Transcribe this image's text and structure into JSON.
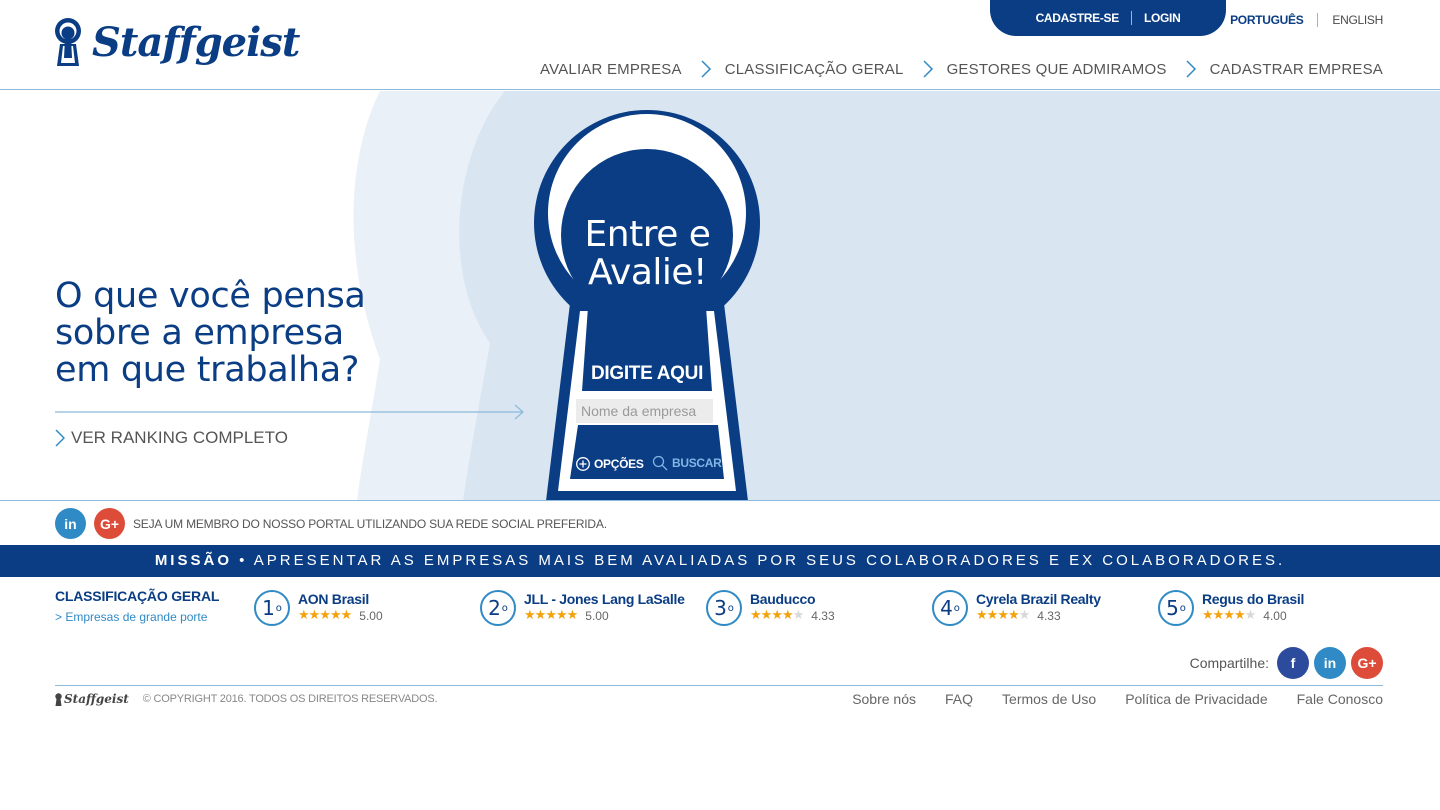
{
  "brand": {
    "name": "Staffgeist"
  },
  "account": {
    "signup": "CADASTRE-SE",
    "login": "LOGIN"
  },
  "language": {
    "pt": "PORTUGUÊS",
    "en": "ENGLISH"
  },
  "nav": {
    "items": [
      "AVALIAR EMPRESA",
      "CLASSIFICAÇÃO GERAL",
      "GESTORES QUE ADMIRAMOS",
      "CADASTRAR EMPRESA"
    ]
  },
  "hero": {
    "headline": [
      "O que você pensa",
      "sobre a empresa",
      "em que trabalha?"
    ],
    "ranking_link": "VER RANKING COMPLETO",
    "keyhole_title": [
      "Entre e",
      "Avalie!"
    ],
    "prompt": "DIGITE AQUI",
    "search_placeholder": "Nome da empresa",
    "options_label": "OPÇÕES",
    "search_label": "BUSCAR"
  },
  "social": {
    "linkedin": "in",
    "googleplus": "G+",
    "text": "SEJA UM MEMBRO DO NOSSO PORTAL UTILIZANDO SUA REDE SOCIAL PREFERIDA."
  },
  "mission": {
    "label": "MISSÃO",
    "bullet": "•",
    "text": "APRESENTAR AS EMPRESAS MAIS BEM AVALIADAS POR SEUS COLABORADORES E EX COLABORADORES."
  },
  "ranking": {
    "title": "CLASSIFICAÇÃO GERAL",
    "subtitle": "> Empresas de grande porte",
    "items": [
      {
        "pos": "1",
        "ord": "o",
        "name": "AON Brasil",
        "stars": 5,
        "score": "5.00"
      },
      {
        "pos": "2",
        "ord": "o",
        "name": "JLL - Jones Lang LaSalle",
        "stars": 5,
        "score": "5.00"
      },
      {
        "pos": "3",
        "ord": "o",
        "name": "Bauducco",
        "stars": 4,
        "score": "4.33"
      },
      {
        "pos": "4",
        "ord": "o",
        "name": "Cyrela Brazil Realty",
        "stars": 4,
        "score": "4.33"
      },
      {
        "pos": "5",
        "ord": "o",
        "name": "Regus do Brasil",
        "stars": 4,
        "score": "4.00"
      }
    ]
  },
  "share": {
    "label": "Compartilhe:",
    "facebook": "f",
    "linkedin": "in",
    "googleplus": "G+"
  },
  "footer": {
    "brand": "Staffgeist",
    "copyright": "© COPYRIGHT 2016. TODOS OS DIREITOS RESERVADOS.",
    "links": [
      "Sobre nós",
      "FAQ",
      "Termos de Uso",
      "Política de Privacidade",
      "Fale Conosco"
    ]
  },
  "colors": {
    "primary": "#0a3d84",
    "accent": "#2f8ac6",
    "hero_bg": "#d9e6f1",
    "star": "#f3a20c"
  },
  "icons": {
    "keyhole": "keyhole-logo-icon",
    "chevron": "chevron-right-icon",
    "plus": "plus-circle-icon",
    "search": "search-icon"
  }
}
